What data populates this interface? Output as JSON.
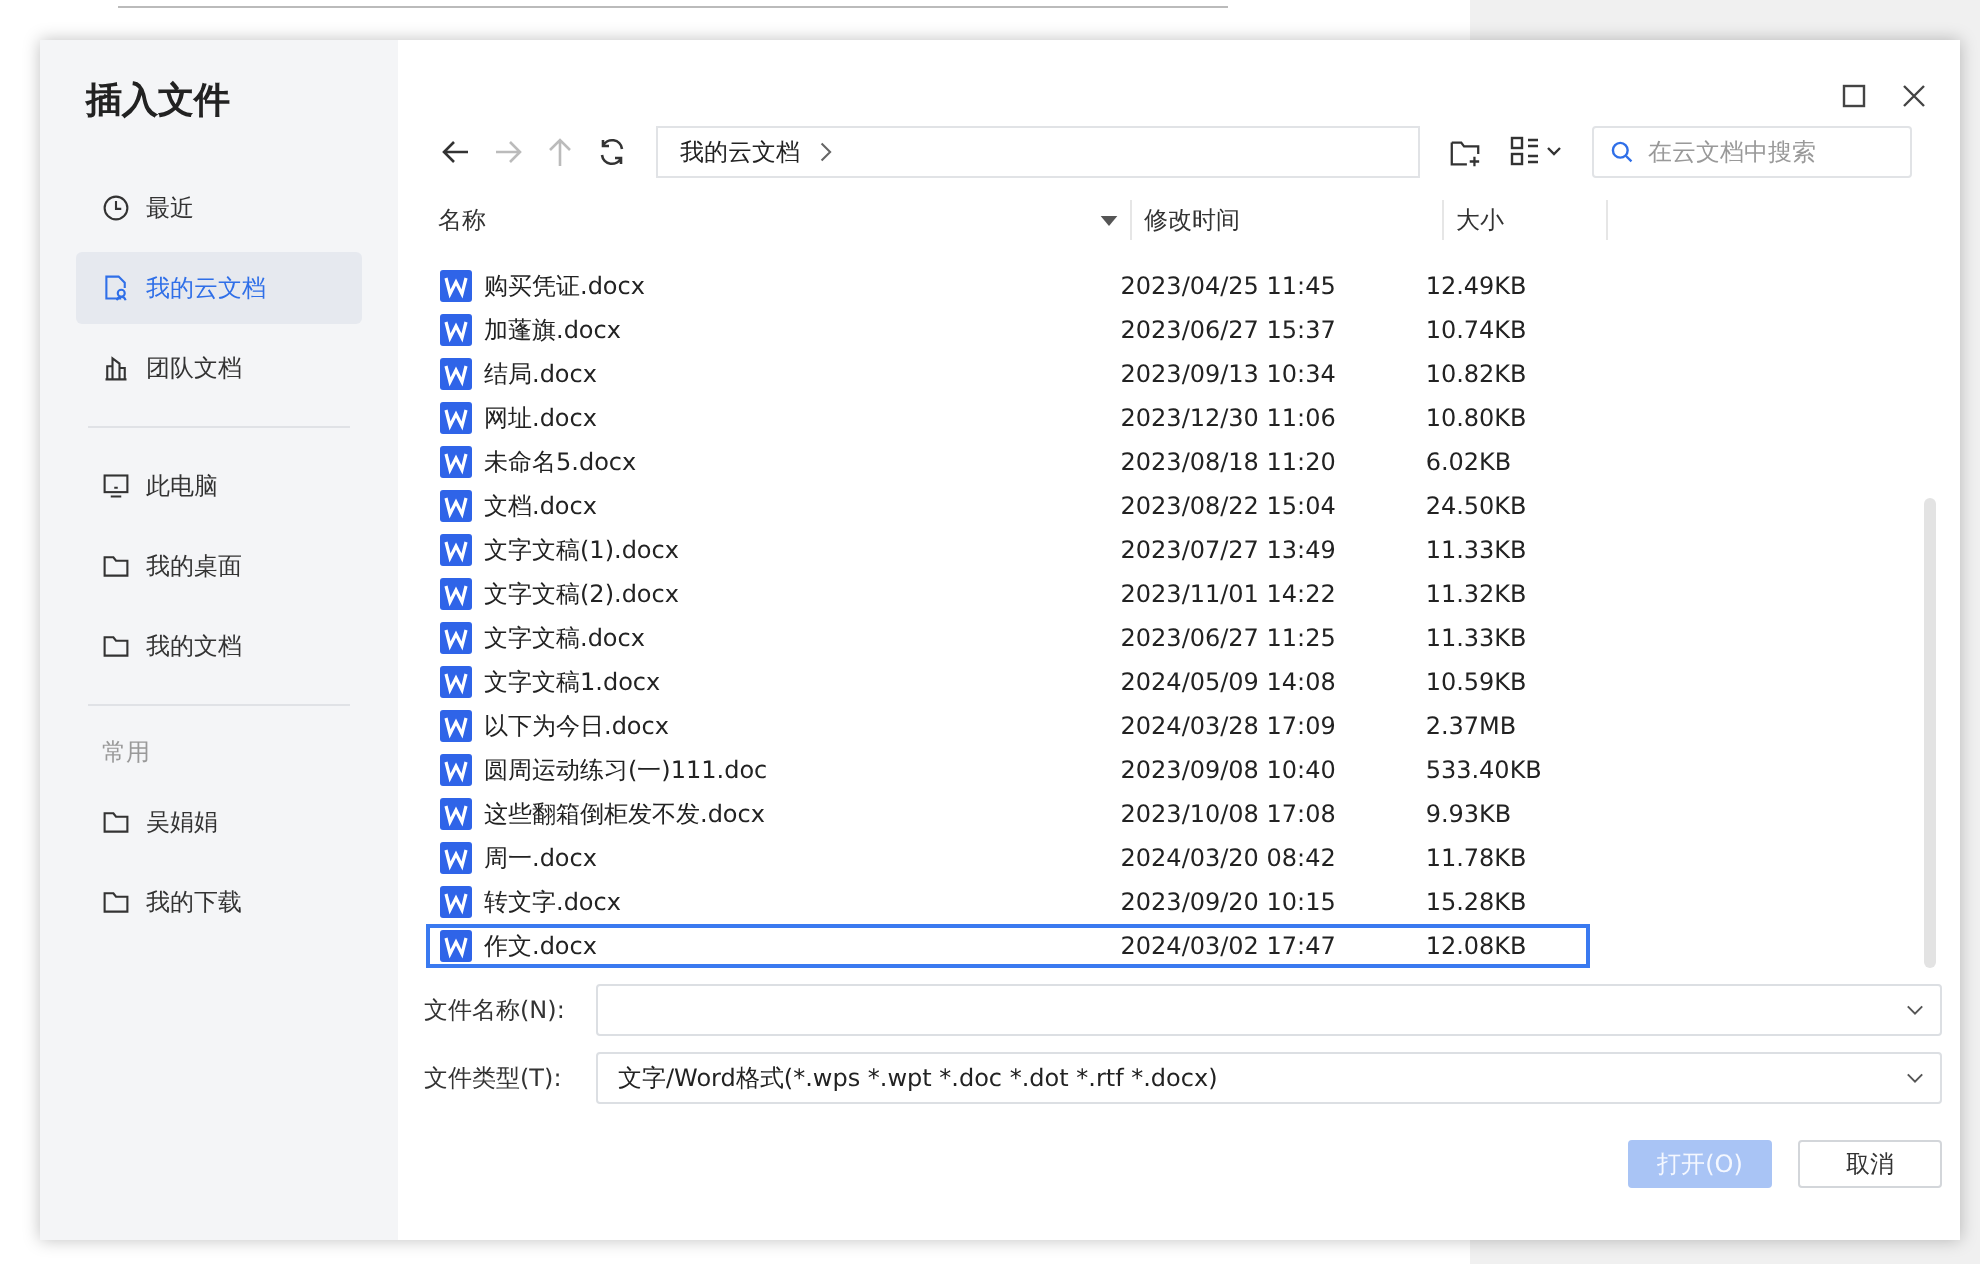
{
  "dialog": {
    "title": "插入文件"
  },
  "sidebar": {
    "items": [
      {
        "label": "最近",
        "kind": "recent",
        "selected": false
      },
      {
        "label": "我的云文档",
        "kind": "cloud",
        "selected": true
      },
      {
        "label": "团队文档",
        "kind": "team",
        "selected": false
      },
      {
        "kind": "divider"
      },
      {
        "label": "此电脑",
        "kind": "computer",
        "selected": false
      },
      {
        "label": "我的桌面",
        "kind": "folder",
        "selected": false
      },
      {
        "label": "我的文档",
        "kind": "folder",
        "selected": false
      },
      {
        "kind": "divider"
      },
      {
        "kind": "heading",
        "label": "常用"
      },
      {
        "label": "吴娟娟",
        "kind": "folder",
        "selected": false
      },
      {
        "label": "我的下载",
        "kind": "folder",
        "selected": false
      }
    ]
  },
  "toolbar": {
    "breadcrumb": "我的云文档",
    "search": {
      "placeholder": "在云文档中搜索"
    }
  },
  "table": {
    "columns": [
      "名称",
      "修改时间",
      "大小"
    ],
    "rows": [
      {
        "name": "购买凭证.docx",
        "modified": "2023/04/25 11:45",
        "size": "12.49KB",
        "highlighted": false
      },
      {
        "name": "加蓬旗.docx",
        "modified": "2023/06/27 15:37",
        "size": "10.74KB",
        "highlighted": false
      },
      {
        "name": "结局.docx",
        "modified": "2023/09/13 10:34",
        "size": "10.82KB",
        "highlighted": false
      },
      {
        "name": "网址.docx",
        "modified": "2023/12/30 11:06",
        "size": "10.80KB",
        "highlighted": false
      },
      {
        "name": "未命名5.docx",
        "modified": "2023/08/18 11:20",
        "size": "6.02KB",
        "highlighted": false
      },
      {
        "name": "文档.docx",
        "modified": "2023/08/22 15:04",
        "size": "24.50KB",
        "highlighted": false
      },
      {
        "name": "文字文稿(1).docx",
        "modified": "2023/07/27 13:49",
        "size": "11.33KB",
        "highlighted": false
      },
      {
        "name": "文字文稿(2).docx",
        "modified": "2023/11/01 14:22",
        "size": "11.32KB",
        "highlighted": false
      },
      {
        "name": "文字文稿.docx",
        "modified": "2023/06/27 11:25",
        "size": "11.33KB",
        "highlighted": false
      },
      {
        "name": "文字文稿1.docx",
        "modified": "2024/05/09 14:08",
        "size": "10.59KB",
        "highlighted": false
      },
      {
        "name": "以下为今日.docx",
        "modified": "2024/03/28 17:09",
        "size": "2.37MB",
        "highlighted": false
      },
      {
        "name": "圆周运动练习(一)111.doc",
        "modified": "2023/09/08 10:40",
        "size": "533.40KB",
        "highlighted": false
      },
      {
        "name": "这些翻箱倒柜发不发.docx",
        "modified": "2023/10/08 17:08",
        "size": "9.93KB",
        "highlighted": false
      },
      {
        "name": "周一.docx",
        "modified": "2024/03/20 08:42",
        "size": "11.78KB",
        "highlighted": false
      },
      {
        "name": "转文字.docx",
        "modified": "2023/09/20 10:15",
        "size": "15.28KB",
        "highlighted": false
      },
      {
        "name": "作文.docx",
        "modified": "2024/03/02 17:47",
        "size": "12.08KB",
        "highlighted": true
      }
    ]
  },
  "file_name": {
    "label": "文件名称(N):"
  },
  "file_type": {
    "label": "文件类型(T):",
    "value": "文字/Word格式(*.wps *.wpt *.doc *.dot *.rtf *.docx)"
  },
  "buttons": [
    {
      "label": "打开(O)",
      "disabled": true
    },
    {
      "label": "取消",
      "disabled": false
    }
  ]
}
